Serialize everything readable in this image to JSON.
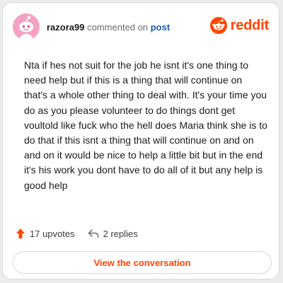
{
  "header": {
    "username": "razora99",
    "action_text": "commented on",
    "post_link": "post",
    "brand_wordmark": "reddit"
  },
  "comment": {
    "body": "Nta if hes not suit for the job he isnt it's one thing to need help but if this is a thing that will continue on that's a whole other thing to deal with. It's your time you do as you please volunteer to do things dont get voultold like fuck who the hell does Maria think she is to do that if this isnt a thing that will continue on and on and on it would be nice to help a little bit but in the end it's his work you dont have to do all of it but any help is good help"
  },
  "stats": {
    "upvotes_label": "17 upvotes",
    "replies_label": "2 replies"
  },
  "cta": {
    "label": "View the conversation"
  },
  "icons": {
    "avatar": "snoo-avatar-icon",
    "brand": "reddit-logo-icon",
    "upvote": "upvote-arrow-icon",
    "reply": "reply-arrow-icon"
  },
  "colors": {
    "accent": "#ff4500",
    "avatar_bg": "#f4a1c3",
    "link": "#1d5aa8",
    "text": "#1a1a1b"
  }
}
